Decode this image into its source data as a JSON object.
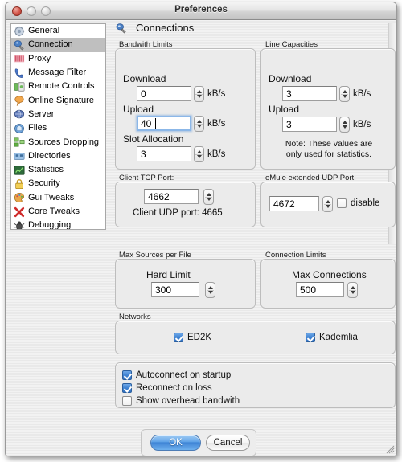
{
  "window": {
    "title": "Preferences",
    "traffic_lights": [
      "close",
      "minimize",
      "zoom"
    ]
  },
  "sidebar": {
    "items": [
      {
        "label": "General",
        "icon": "gear-icon",
        "selected": false
      },
      {
        "label": "Connection",
        "icon": "connection-icon",
        "selected": true
      },
      {
        "label": "Proxy",
        "icon": "proxy-icon",
        "selected": false
      },
      {
        "label": "Message Filter",
        "icon": "phone-icon",
        "selected": false
      },
      {
        "label": "Remote Controls",
        "icon": "remote-icon",
        "selected": false
      },
      {
        "label": "Online Signature",
        "icon": "signature-icon",
        "selected": false
      },
      {
        "label": "Server",
        "icon": "server-icon",
        "selected": false
      },
      {
        "label": "Files",
        "icon": "files-icon",
        "selected": false
      },
      {
        "label": "Sources Dropping",
        "icon": "sources-icon",
        "selected": false
      },
      {
        "label": "Directories",
        "icon": "folder-icon",
        "selected": false
      },
      {
        "label": "Statistics",
        "icon": "statistics-icon",
        "selected": false
      },
      {
        "label": "Security",
        "icon": "lock-icon",
        "selected": false
      },
      {
        "label": "Gui Tweaks",
        "icon": "palette-icon",
        "selected": false
      },
      {
        "label": "Core Tweaks",
        "icon": "x-cross-icon",
        "selected": false
      },
      {
        "label": "Debugging",
        "icon": "bug-icon",
        "selected": false
      }
    ]
  },
  "pane": {
    "title": "Connections",
    "icon": "connection-icon"
  },
  "bandwith_limits": {
    "group_label": "Bandwith Limits",
    "download_label": "Download",
    "download_value": "0",
    "download_unit": "kB/s",
    "upload_label": "Upload",
    "upload_value": "40",
    "upload_unit": "kB/s",
    "upload_focused": true,
    "slot_label": "Slot Allocation",
    "slot_value": "3",
    "slot_unit": "kB/s"
  },
  "line_capacities": {
    "group_label": "Line Capacities",
    "download_label": "Download",
    "download_value": "3",
    "download_unit": "kB/s",
    "upload_label": "Upload",
    "upload_value": "3",
    "upload_unit": "kB/s",
    "note_line1": "Note: These values are",
    "note_line2": "only used for statistics."
  },
  "client_tcp_port": {
    "group_label": "Client TCP Port:",
    "value": "4662",
    "udp_text": "Client UDP port: 4665"
  },
  "emule_udp_port": {
    "group_label": "eMule extended UDP Port:",
    "value": "4672",
    "disable_label": "disable",
    "disable_checked": false
  },
  "max_sources": {
    "group_label": "Max Sources per File",
    "hard_limit_label": "Hard Limit",
    "hard_limit_value": "300"
  },
  "connection_limits": {
    "group_label": "Connection Limits",
    "max_connections_label": "Max Connections",
    "max_connections_value": "500"
  },
  "networks": {
    "group_label": "Networks",
    "ed2k_label": "ED2K",
    "ed2k_checked": true,
    "kademlia_label": "Kademlia",
    "kademlia_checked": true
  },
  "options": [
    {
      "label": "Autoconnect on startup",
      "checked": true
    },
    {
      "label": "Reconnect on loss",
      "checked": true
    },
    {
      "label": "Show overhead bandwith",
      "checked": false
    }
  ],
  "buttons": {
    "ok_label": "OK",
    "cancel_label": "Cancel"
  },
  "colors": {
    "accent_blue": "#3f84d6",
    "selection_gray": "#bfbfbf",
    "window_bg": "#ededed"
  }
}
